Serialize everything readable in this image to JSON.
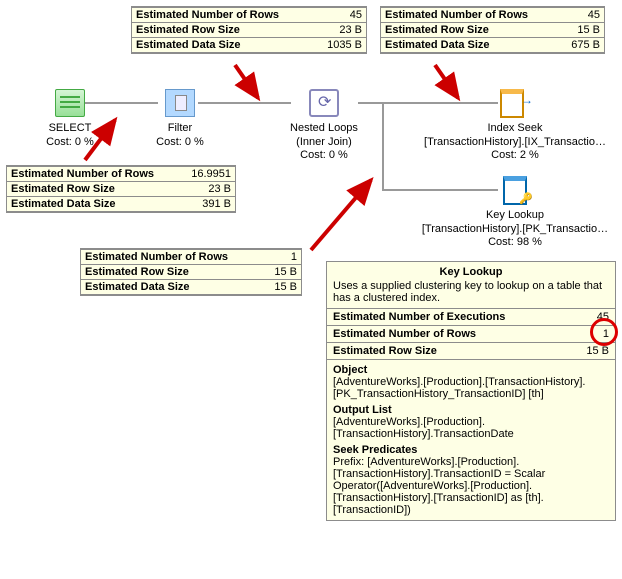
{
  "tooltips": {
    "t1": {
      "rows_l": "Estimated Number of Rows",
      "rows_v": "45",
      "size_l": "Estimated Row Size",
      "size_v": "23 B",
      "data_l": "Estimated Data Size",
      "data_v": "1035 B"
    },
    "t2": {
      "rows_l": "Estimated Number of Rows",
      "rows_v": "45",
      "size_l": "Estimated Row Size",
      "size_v": "15 B",
      "data_l": "Estimated Data Size",
      "data_v": "675 B"
    },
    "t3": {
      "rows_l": "Estimated Number of Rows",
      "rows_v": "16.9951",
      "size_l": "Estimated Row Size",
      "size_v": "23 B",
      "data_l": "Estimated Data Size",
      "data_v": "391 B"
    },
    "t4": {
      "rows_l": "Estimated Number of Rows",
      "rows_v": "1",
      "size_l": "Estimated Row Size",
      "size_v": "15 B",
      "data_l": "Estimated Data Size",
      "data_v": "15 B"
    }
  },
  "ops": {
    "select": {
      "name": "SELECT",
      "cost": "Cost: 0 %"
    },
    "filter": {
      "name": "Filter",
      "cost": "Cost: 0 %"
    },
    "loop": {
      "name": "Nested Loops",
      "sub": "(Inner Join)",
      "cost": "Cost: 0 %"
    },
    "seek": {
      "name": "Index Seek",
      "obj": "[TransactionHistory].[IX_Transactio…",
      "cost": "Cost: 2 %"
    },
    "lookup": {
      "name": "Key Lookup",
      "obj": "[TransactionHistory].[PK_Transactio…",
      "cost": "Cost: 98 %"
    }
  },
  "big": {
    "title": "Key Lookup",
    "desc": "Uses a supplied clustering key to lookup on a table that has a clustered index.",
    "exec_l": "Estimated Number of Executions",
    "exec_v": "45",
    "rows_l": "Estimated Number of Rows",
    "rows_v": "1",
    "size_l": "Estimated Row Size",
    "size_v": "15 B",
    "obj_h": "Object",
    "obj_b": "[AdventureWorks].[Production].[TransactionHistory].[PK_TransactionHistory_TransactionID] [th]",
    "out_h": "Output List",
    "out_b": "[AdventureWorks].[Production].[TransactionHistory].TransactionDate",
    "seek_h": "Seek Predicates",
    "seek_b": "Prefix: [AdventureWorks].[Production].[TransactionHistory].TransactionID = Scalar Operator([AdventureWorks].[Production].[TransactionHistory].[TransactionID] as [th].[TransactionID])"
  }
}
